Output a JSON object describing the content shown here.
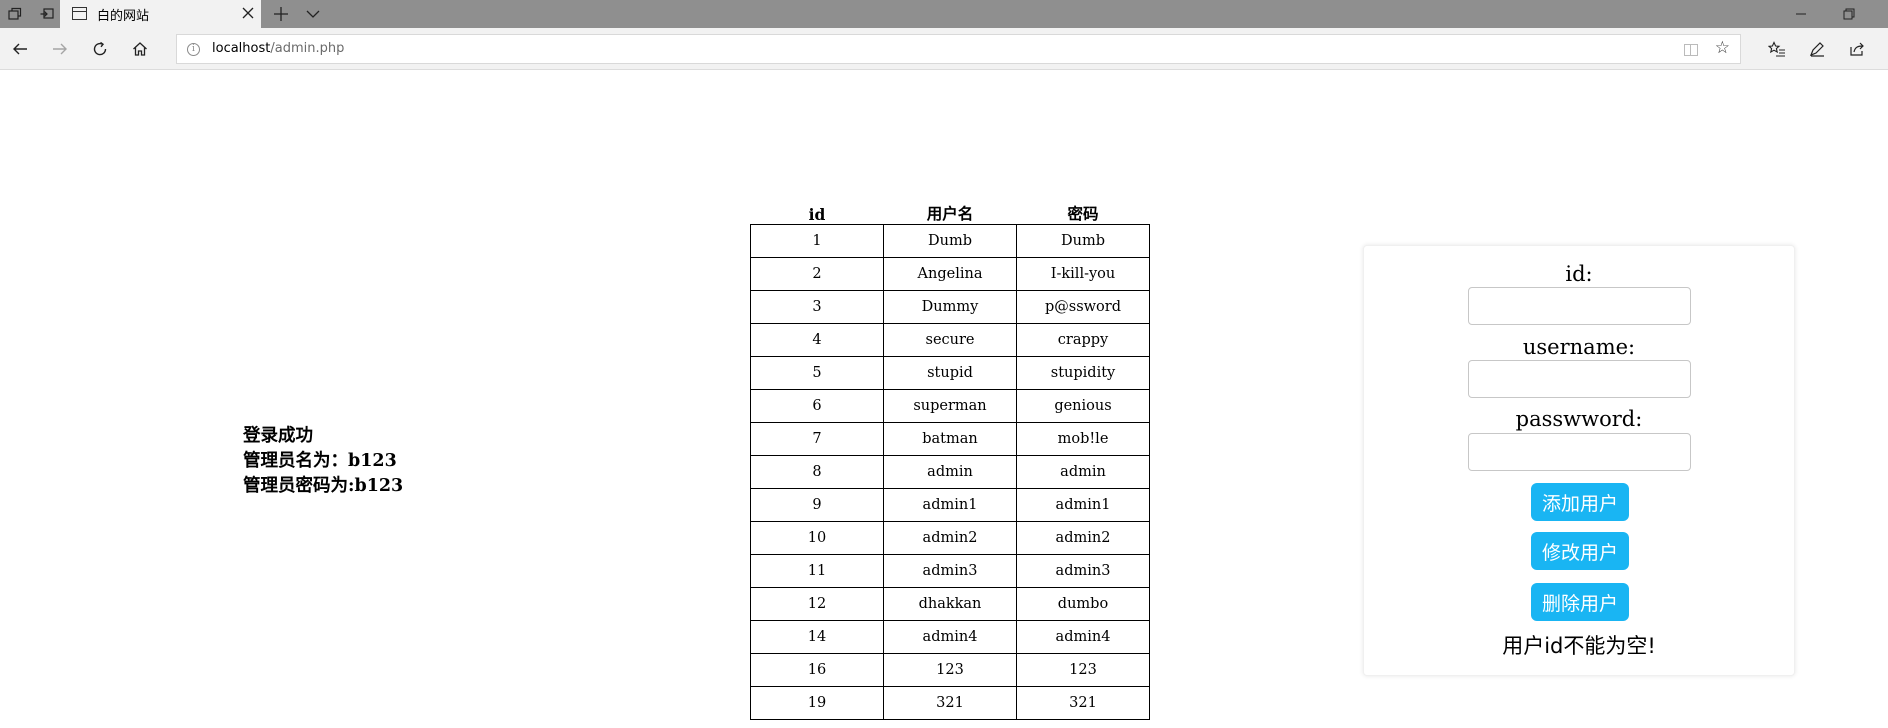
{
  "browser": {
    "tab_title": "白的网站",
    "url_host": "localhost",
    "url_path": "/admin.php"
  },
  "login_info": {
    "line1": "登录成功",
    "line2": "管理员名为：b123",
    "line3": "管理员密码为:b123"
  },
  "table": {
    "headers": [
      "id",
      "用户名",
      "密码"
    ],
    "rows": [
      [
        "1",
        "Dumb",
        "Dumb"
      ],
      [
        "2",
        "Angelina",
        "I-kill-you"
      ],
      [
        "3",
        "Dummy",
        "p@ssword"
      ],
      [
        "4",
        "secure",
        "crappy"
      ],
      [
        "5",
        "stupid",
        "stupidity"
      ],
      [
        "6",
        "superman",
        "genious"
      ],
      [
        "7",
        "batman",
        "mob!le"
      ],
      [
        "8",
        "admin",
        "admin"
      ],
      [
        "9",
        "admin1",
        "admin1"
      ],
      [
        "10",
        "admin2",
        "admin2"
      ],
      [
        "11",
        "admin3",
        "admin3"
      ],
      [
        "12",
        "dhakkan",
        "dumbo"
      ],
      [
        "14",
        "admin4",
        "admin4"
      ],
      [
        "16",
        "123",
        "123"
      ],
      [
        "19",
        "321",
        "321"
      ]
    ]
  },
  "form": {
    "id_label": "id:",
    "username_label": "username:",
    "password_label": "passwword:",
    "id_value": "",
    "username_value": "",
    "password_value": "",
    "add_button": "添加用户",
    "modify_button": "修改用户",
    "delete_button": "删除用户",
    "message": "用户id不能为空!"
  },
  "colors": {
    "button_bg": "#19b5f3",
    "tabbar_bg": "#8f8f8f",
    "navbar_bg": "#f2f2f2"
  }
}
